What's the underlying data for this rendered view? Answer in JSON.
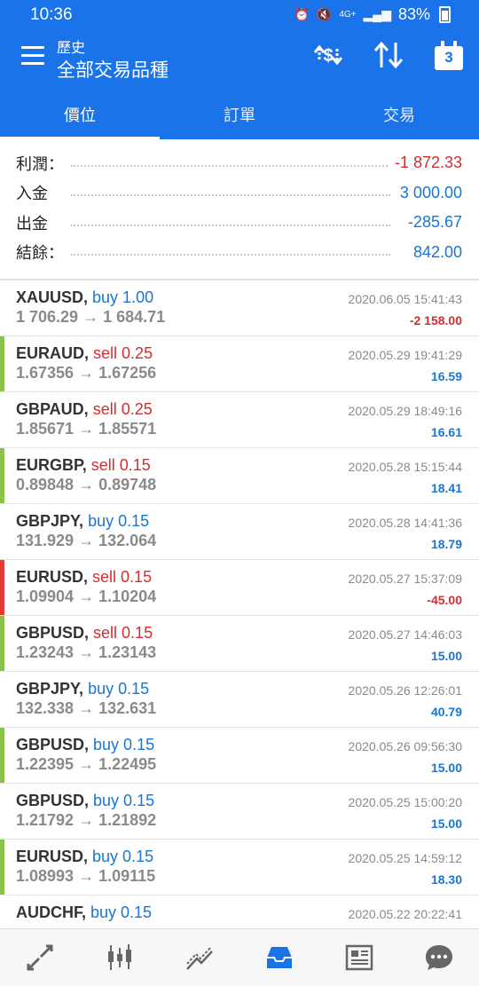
{
  "status_bar": {
    "time": "10:36",
    "network": "4G+",
    "battery": "83%"
  },
  "header": {
    "subtitle": "歷史",
    "title": "全部交易品種",
    "calendar_day": "3",
    "tabs": [
      {
        "label": "價位",
        "active": true
      },
      {
        "label": "訂單",
        "active": false
      },
      {
        "label": "交易",
        "active": false
      }
    ]
  },
  "summary": [
    {
      "label": "利潤：",
      "value": "-1 872.33",
      "sign": "neg"
    },
    {
      "label": "入金",
      "value": "3 000.00",
      "sign": "pos"
    },
    {
      "label": "出金",
      "value": "-285.67",
      "sign": "pos"
    },
    {
      "label": "結餘：",
      "value": "842.00",
      "sign": "pos"
    }
  ],
  "trades": [
    {
      "symbol": "XAUUSD,",
      "action": "buy 1.00",
      "side": "buy",
      "open": "1 706.29",
      "close": "1 684.71",
      "time": "2020.06.05 15:41:43",
      "profit": "-2 158.00",
      "profit_sign": "neg",
      "bar": "none"
    },
    {
      "symbol": "EURAUD,",
      "action": "sell 0.25",
      "side": "sell",
      "open": "1.67356",
      "close": "1.67256",
      "time": "2020.05.29 19:41:29",
      "profit": "16.59",
      "profit_sign": "pos",
      "bar": "green"
    },
    {
      "symbol": "GBPAUD,",
      "action": "sell 0.25",
      "side": "sell",
      "open": "1.85671",
      "close": "1.85571",
      "time": "2020.05.29 18:49:16",
      "profit": "16.61",
      "profit_sign": "pos",
      "bar": "none"
    },
    {
      "symbol": "EURGBP,",
      "action": "sell 0.15",
      "side": "sell",
      "open": "0.89848",
      "close": "0.89748",
      "time": "2020.05.28 15:15:44",
      "profit": "18.41",
      "profit_sign": "pos",
      "bar": "green"
    },
    {
      "symbol": "GBPJPY,",
      "action": "buy 0.15",
      "side": "buy",
      "open": "131.929",
      "close": "132.064",
      "time": "2020.05.28 14:41:36",
      "profit": "18.79",
      "profit_sign": "pos",
      "bar": "none"
    },
    {
      "symbol": "EURUSD,",
      "action": "sell 0.15",
      "side": "sell",
      "open": "1.09904",
      "close": "1.10204",
      "time": "2020.05.27 15:37:09",
      "profit": "-45.00",
      "profit_sign": "neg",
      "bar": "red"
    },
    {
      "symbol": "GBPUSD,",
      "action": "sell 0.15",
      "side": "sell",
      "open": "1.23243",
      "close": "1.23143",
      "time": "2020.05.27 14:46:03",
      "profit": "15.00",
      "profit_sign": "pos",
      "bar": "green"
    },
    {
      "symbol": "GBPJPY,",
      "action": "buy 0.15",
      "side": "buy",
      "open": "132.338",
      "close": "132.631",
      "time": "2020.05.26 12:26:01",
      "profit": "40.79",
      "profit_sign": "pos",
      "bar": "none"
    },
    {
      "symbol": "GBPUSD,",
      "action": "buy 0.15",
      "side": "buy",
      "open": "1.22395",
      "close": "1.22495",
      "time": "2020.05.26 09:56:30",
      "profit": "15.00",
      "profit_sign": "pos",
      "bar": "green"
    },
    {
      "symbol": "GBPUSD,",
      "action": "buy 0.15",
      "side": "buy",
      "open": "1.21792",
      "close": "1.21892",
      "time": "2020.05.25 15:00:20",
      "profit": "15.00",
      "profit_sign": "pos",
      "bar": "none"
    },
    {
      "symbol": "EURUSD,",
      "action": "buy 0.15",
      "side": "buy",
      "open": "1.08993",
      "close": "1.09115",
      "time": "2020.05.25 14:59:12",
      "profit": "18.30",
      "profit_sign": "pos",
      "bar": "green"
    },
    {
      "symbol": "AUDCHF,",
      "action": "buy 0.15",
      "side": "buy",
      "open": "",
      "close": "",
      "time": "2020.05.22 20:22:41",
      "profit": "",
      "profit_sign": "pos",
      "bar": "none"
    }
  ],
  "colors": {
    "primary": "#1a73e8",
    "positive": "#1976d2",
    "negative": "#d32f2f",
    "bar_green": "#8bc34a",
    "bar_red": "#e53935"
  },
  "bottom_nav": [
    {
      "icon": "quotes-icon"
    },
    {
      "icon": "chart-icon"
    },
    {
      "icon": "trade-icon"
    },
    {
      "icon": "history-icon",
      "active": true
    },
    {
      "icon": "news-icon"
    },
    {
      "icon": "chat-icon"
    }
  ]
}
